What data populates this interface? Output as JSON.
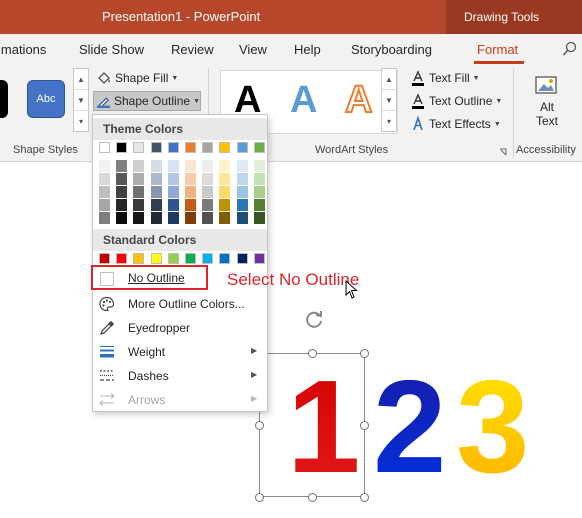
{
  "titlebar": {
    "title": "Presentation1  -  PowerPoint",
    "context_tab": "Drawing Tools"
  },
  "tabs": [
    {
      "label": "imations"
    },
    {
      "label": "Slide Show"
    },
    {
      "label": "Review"
    },
    {
      "label": "View"
    },
    {
      "label": "Help"
    },
    {
      "label": "Storyboarding"
    },
    {
      "label": "Format",
      "active": true
    }
  ],
  "ribbon": {
    "shape_style_sample": "Abc",
    "shape_fill": "Shape Fill",
    "shape_outline": "Shape Outline",
    "wordart_letter": "A",
    "text_fill": "Text Fill",
    "text_outline": "Text Outline",
    "text_effects": "Text Effects",
    "alt_text_line1": "Alt",
    "alt_text_line2": "Text",
    "groups": {
      "shape_styles": "Shape Styles",
      "wordart_styles": "WordArt Styles",
      "accessibility": "Accessibility"
    }
  },
  "dropdown": {
    "theme_colors_heading": "Theme Colors",
    "standard_colors_heading": "Standard Colors",
    "theme_top_row": [
      "#ffffff",
      "#000000",
      "#e7e6e6",
      "#44546a",
      "#4472c4",
      "#ed7d31",
      "#a5a5a5",
      "#ffc000",
      "#5b9bd5",
      "#70ad47"
    ],
    "theme_shades": [
      [
        "#f2f2f2",
        "#808080",
        "#d0cece",
        "#d6dce4",
        "#d9e2f3",
        "#fbe5d5",
        "#ededed",
        "#fff2cc",
        "#deebf6",
        "#e2efd9"
      ],
      [
        "#d9d9d9",
        "#595959",
        "#aeabab",
        "#adb9ca",
        "#b4c6e7",
        "#f7cbac",
        "#dbdbdb",
        "#fee599",
        "#bdd7ee",
        "#c5e0b3"
      ],
      [
        "#bfbfbf",
        "#404040",
        "#757070",
        "#8496b0",
        "#8eaadb",
        "#f4b183",
        "#c9c9c9",
        "#ffd965",
        "#9cc3e5",
        "#a8d08d"
      ],
      [
        "#a6a6a6",
        "#262626",
        "#3a3838",
        "#323f4f",
        "#2f5496",
        "#c55a11",
        "#7b7b7b",
        "#bf9000",
        "#2e75b5",
        "#538135"
      ],
      [
        "#7f7f7f",
        "#0d0d0d",
        "#171616",
        "#222a35",
        "#1f3864",
        "#843c0b",
        "#525252",
        "#7f6000",
        "#1e4e79",
        "#375623"
      ]
    ],
    "standard_colors": [
      "#c00000",
      "#ff0000",
      "#ffc000",
      "#ffff00",
      "#92d050",
      "#00b050",
      "#00b0f0",
      "#0070c0",
      "#002060",
      "#7030a0"
    ],
    "items": [
      {
        "label": "No Outline"
      },
      {
        "label": "More Outline Colors..."
      },
      {
        "label": "Eyedropper"
      },
      {
        "label": "Weight"
      },
      {
        "label": "Dashes"
      },
      {
        "label": "Arrows"
      }
    ]
  },
  "annotation": "Select No Outline",
  "slide_numbers": [
    "1",
    "2",
    "3"
  ]
}
